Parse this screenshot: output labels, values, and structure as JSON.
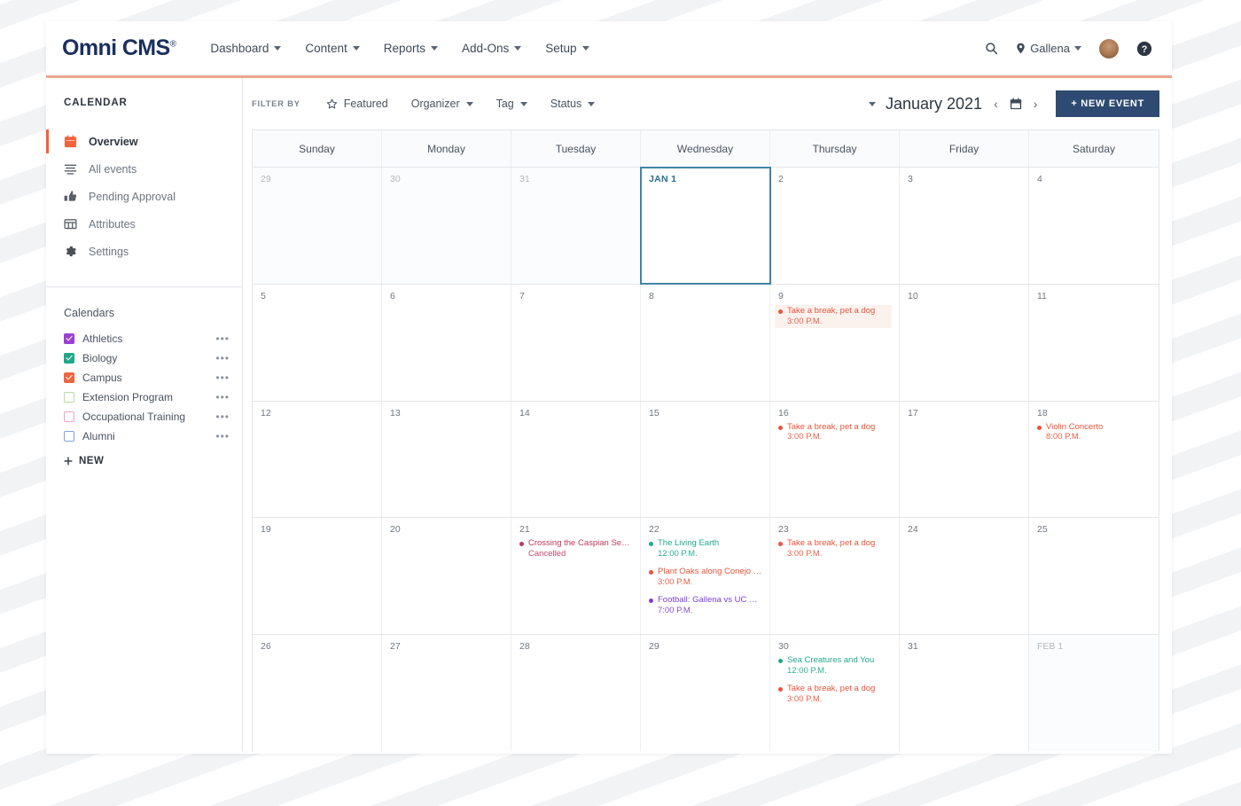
{
  "brand": {
    "name": "Omni CMS",
    "tm": "®"
  },
  "header": {
    "nav": [
      {
        "label": "Dashboard"
      },
      {
        "label": "Content"
      },
      {
        "label": "Reports"
      },
      {
        "label": "Add-Ons"
      },
      {
        "label": "Setup"
      }
    ],
    "search_icon": "search-icon",
    "site": "Gallena",
    "help_icon": "help-icon",
    "accent_underline": "#e8a88e"
  },
  "sidebar": {
    "title": "CALENDAR",
    "items": [
      {
        "label": "Overview",
        "icon": "calendar-icon",
        "active": true
      },
      {
        "label": "All events",
        "icon": "list-icon",
        "active": false
      },
      {
        "label": "Pending Approval",
        "icon": "thumbs-up-icon",
        "active": false
      },
      {
        "label": "Attributes",
        "icon": "attributes-icon",
        "active": false
      },
      {
        "label": "Settings",
        "icon": "gear-icon",
        "active": false
      }
    ],
    "calendars_heading": "Calendars",
    "calendars": [
      {
        "label": "Athletics",
        "color": "#9b3fd4",
        "checked": true
      },
      {
        "label": "Biology",
        "color": "#1fa98a",
        "checked": true
      },
      {
        "label": "Campus",
        "color": "#f2633f",
        "checked": true
      },
      {
        "label": "Extension Program",
        "color": "#b9d8a4",
        "checked": false
      },
      {
        "label": "Occupational Training",
        "color": "#efa3bd",
        "checked": false
      },
      {
        "label": "Alumni",
        "color": "#7fa4e0",
        "checked": false
      }
    ],
    "new_calendar_label": "NEW",
    "menu_dots": "•••"
  },
  "toolbar": {
    "filter_label": "FILTER BY",
    "featured_label": "Featured",
    "featured_icon": "star-icon",
    "filters": [
      {
        "label": "Organizer"
      },
      {
        "label": "Tag"
      },
      {
        "label": "Status"
      }
    ],
    "month_label": "January 2021",
    "prev_label": "‹",
    "next_label": "›",
    "datepicker_icon": "calendar-picker-icon",
    "new_event_label": "+ NEW EVENT",
    "new_event_color": "#2e4a72"
  },
  "calendar": {
    "day_headers": [
      "Sunday",
      "Monday",
      "Tuesday",
      "Wednesday",
      "Thursday",
      "Friday",
      "Saturday"
    ],
    "weeks": [
      [
        {
          "num": "29",
          "out": true,
          "events": []
        },
        {
          "num": "30",
          "out": true,
          "events": []
        },
        {
          "num": "31",
          "out": true,
          "events": []
        },
        {
          "num": "JAN 1",
          "out": false,
          "today": true,
          "events": []
        },
        {
          "num": "2",
          "out": false,
          "events": []
        },
        {
          "num": "3",
          "out": false,
          "events": []
        },
        {
          "num": "4",
          "out": false,
          "events": []
        }
      ],
      [
        {
          "num": "5",
          "out": false,
          "events": []
        },
        {
          "num": "6",
          "out": false,
          "events": []
        },
        {
          "num": "7",
          "out": false,
          "events": []
        },
        {
          "num": "8",
          "out": false,
          "events": []
        },
        {
          "num": "9",
          "out": false,
          "events": [
            {
              "title": "Take a break, pet a dog",
              "time": "3:00 P.M.",
              "color": "#e8553a",
              "highlight": true
            }
          ]
        },
        {
          "num": "10",
          "out": false,
          "events": []
        },
        {
          "num": "11",
          "out": false,
          "events": []
        }
      ],
      [
        {
          "num": "12",
          "out": false,
          "events": []
        },
        {
          "num": "13",
          "out": false,
          "events": []
        },
        {
          "num": "14",
          "out": false,
          "events": []
        },
        {
          "num": "15",
          "out": false,
          "events": []
        },
        {
          "num": "16",
          "out": false,
          "events": [
            {
              "title": "Take a break, pet a dog",
              "time": "3:00 P.M.",
              "color": "#e8553a",
              "highlight": false
            }
          ]
        },
        {
          "num": "17",
          "out": false,
          "events": []
        },
        {
          "num": "18",
          "out": false,
          "events": [
            {
              "title": "Violin Concerto",
              "time": "8:00 P.M.",
              "color": "#e8553a",
              "highlight": false
            }
          ]
        }
      ],
      [
        {
          "num": "19",
          "out": false,
          "events": []
        },
        {
          "num": "20",
          "out": false,
          "events": []
        },
        {
          "num": "21",
          "out": false,
          "events": [
            {
              "title": "Crossing the Caspian Sea...",
              "time": "Cancelled",
              "color": "#c0395c",
              "highlight": false
            }
          ]
        },
        {
          "num": "22",
          "out": false,
          "events": [
            {
              "title": "The Living Earth",
              "time": "12:00 P.M.",
              "color": "#1fa98a",
              "highlight": false
            },
            {
              "title": "Plant Oaks along Conejo Creek",
              "time": "3:00 P.M.",
              "color": "#e8553a",
              "highlight": false
            },
            {
              "title": "Football: Gallena vs UC San...",
              "time": "7:00 P.M.",
              "color": "#7b3fd4",
              "highlight": false
            }
          ]
        },
        {
          "num": "23",
          "out": false,
          "events": [
            {
              "title": "Take a break, pet a dog",
              "time": "3:00 P.M.",
              "color": "#e8553a",
              "highlight": false
            }
          ]
        },
        {
          "num": "24",
          "out": false,
          "events": []
        },
        {
          "num": "25",
          "out": false,
          "events": []
        }
      ],
      [
        {
          "num": "26",
          "out": false,
          "events": []
        },
        {
          "num": "27",
          "out": false,
          "events": []
        },
        {
          "num": "28",
          "out": false,
          "events": []
        },
        {
          "num": "29",
          "out": false,
          "events": []
        },
        {
          "num": "30",
          "out": false,
          "events": [
            {
              "title": "Sea Creatures and You",
              "time": "12:00 P.M.",
              "color": "#1fa98a",
              "highlight": false
            },
            {
              "title": "Take a break, pet a dog",
              "time": "3:00 P.M.",
              "color": "#e8553a",
              "highlight": false
            }
          ]
        },
        {
          "num": "31",
          "out": false,
          "events": []
        },
        {
          "num": "FEB 1",
          "out": true,
          "events": []
        }
      ]
    ]
  }
}
